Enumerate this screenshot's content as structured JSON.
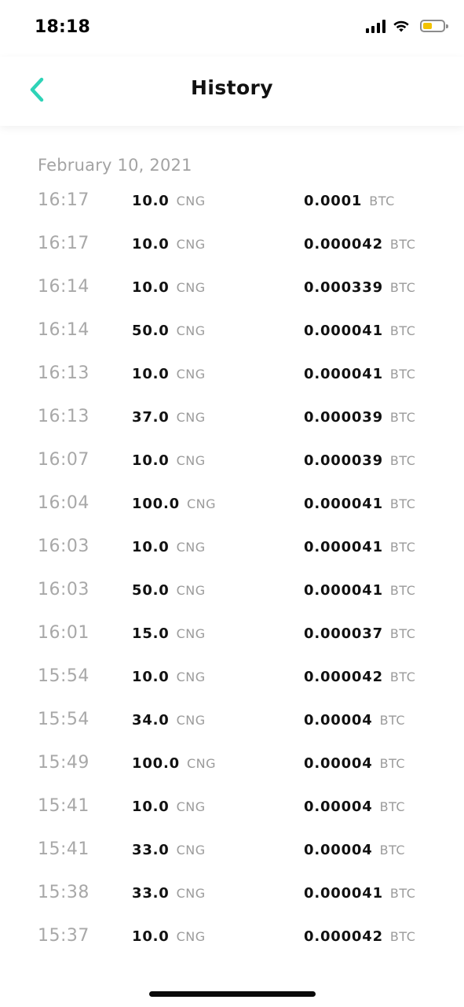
{
  "status_bar": {
    "time": "18:18",
    "battery_color": "#f2c200"
  },
  "header": {
    "title": "History",
    "back_icon": "chevron-left-icon",
    "accent": "#2ed3b7"
  },
  "history": {
    "date": "February 10, 2021",
    "rows": [
      {
        "time": "16:17",
        "amount": "10.0",
        "amount_unit": "CNG",
        "price": "0.0001",
        "price_unit": "BTC"
      },
      {
        "time": "16:17",
        "amount": "10.0",
        "amount_unit": "CNG",
        "price": "0.000042",
        "price_unit": "BTC"
      },
      {
        "time": "16:14",
        "amount": "10.0",
        "amount_unit": "CNG",
        "price": "0.000339",
        "price_unit": "BTC"
      },
      {
        "time": "16:14",
        "amount": "50.0",
        "amount_unit": "CNG",
        "price": "0.000041",
        "price_unit": "BTC"
      },
      {
        "time": "16:13",
        "amount": "10.0",
        "amount_unit": "CNG",
        "price": "0.000041",
        "price_unit": "BTC"
      },
      {
        "time": "16:13",
        "amount": "37.0",
        "amount_unit": "CNG",
        "price": "0.000039",
        "price_unit": "BTC"
      },
      {
        "time": "16:07",
        "amount": "10.0",
        "amount_unit": "CNG",
        "price": "0.000039",
        "price_unit": "BTC"
      },
      {
        "time": "16:04",
        "amount": "100.0",
        "amount_unit": "CNG",
        "price": "0.000041",
        "price_unit": "BTC"
      },
      {
        "time": "16:03",
        "amount": "10.0",
        "amount_unit": "CNG",
        "price": "0.000041",
        "price_unit": "BTC"
      },
      {
        "time": "16:03",
        "amount": "50.0",
        "amount_unit": "CNG",
        "price": "0.000041",
        "price_unit": "BTC"
      },
      {
        "time": "16:01",
        "amount": "15.0",
        "amount_unit": "CNG",
        "price": "0.000037",
        "price_unit": "BTC"
      },
      {
        "time": "15:54",
        "amount": "10.0",
        "amount_unit": "CNG",
        "price": "0.000042",
        "price_unit": "BTC"
      },
      {
        "time": "15:54",
        "amount": "34.0",
        "amount_unit": "CNG",
        "price": "0.00004",
        "price_unit": "BTC"
      },
      {
        "time": "15:49",
        "amount": "100.0",
        "amount_unit": "CNG",
        "price": "0.00004",
        "price_unit": "BTC"
      },
      {
        "time": "15:41",
        "amount": "10.0",
        "amount_unit": "CNG",
        "price": "0.00004",
        "price_unit": "BTC"
      },
      {
        "time": "15:41",
        "amount": "33.0",
        "amount_unit": "CNG",
        "price": "0.00004",
        "price_unit": "BTC"
      },
      {
        "time": "15:38",
        "amount": "33.0",
        "amount_unit": "CNG",
        "price": "0.000041",
        "price_unit": "BTC"
      },
      {
        "time": "15:37",
        "amount": "10.0",
        "amount_unit": "CNG",
        "price": "0.000042",
        "price_unit": "BTC"
      }
    ]
  }
}
